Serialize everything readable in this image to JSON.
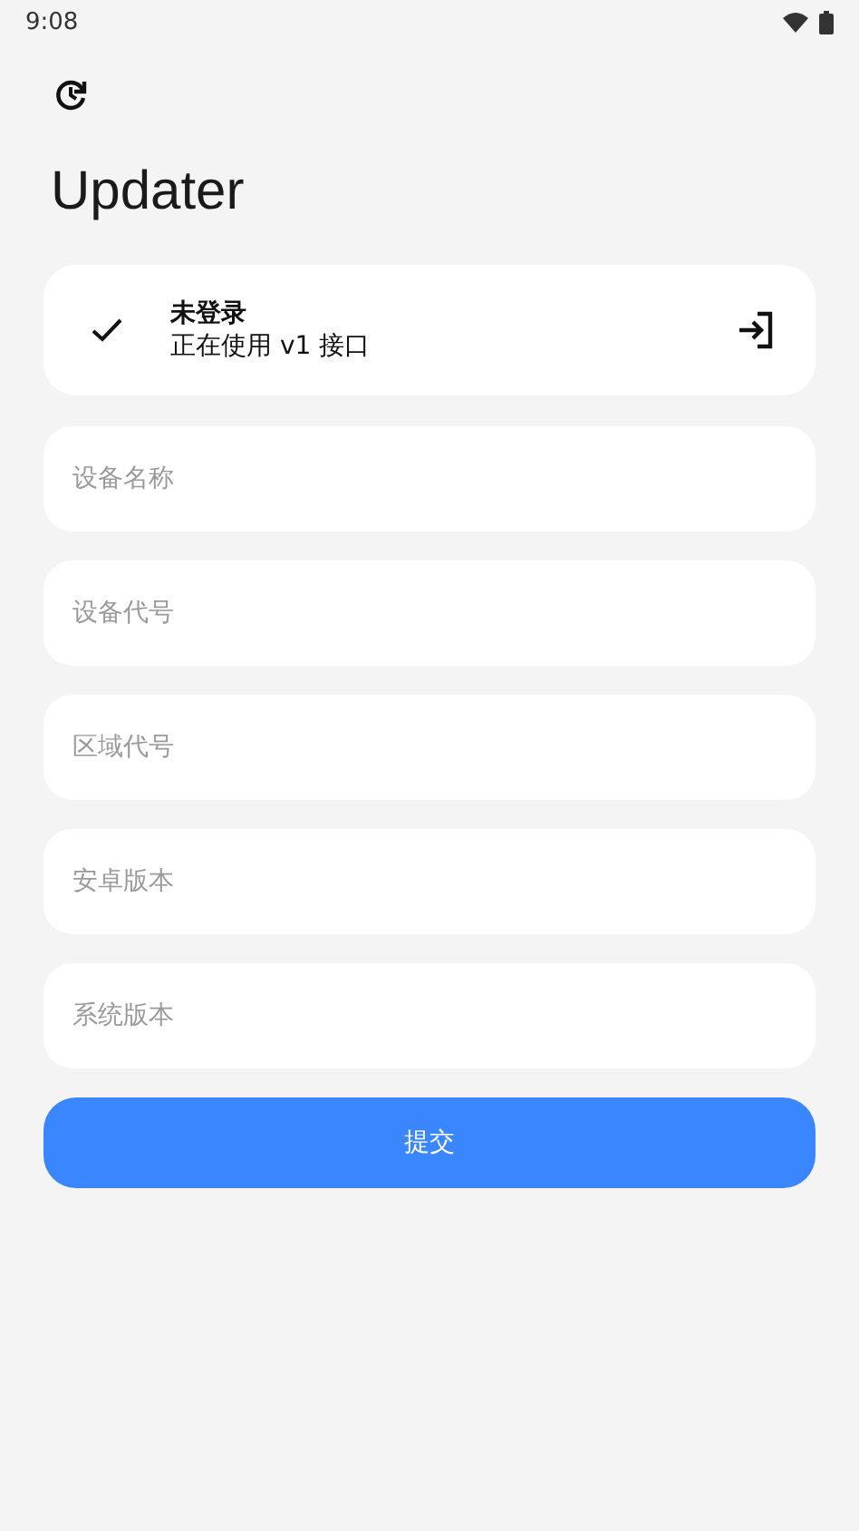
{
  "status_bar": {
    "time": "9:08"
  },
  "title": "Updater",
  "account": {
    "status": "未登录",
    "api": "正在使用 v1 接口"
  },
  "fields": [
    {
      "placeholder": "设备名称"
    },
    {
      "placeholder": "设备代号"
    },
    {
      "placeholder": "区域代号"
    },
    {
      "placeholder": "安卓版本"
    },
    {
      "placeholder": "系统版本"
    }
  ],
  "submit": "提交"
}
